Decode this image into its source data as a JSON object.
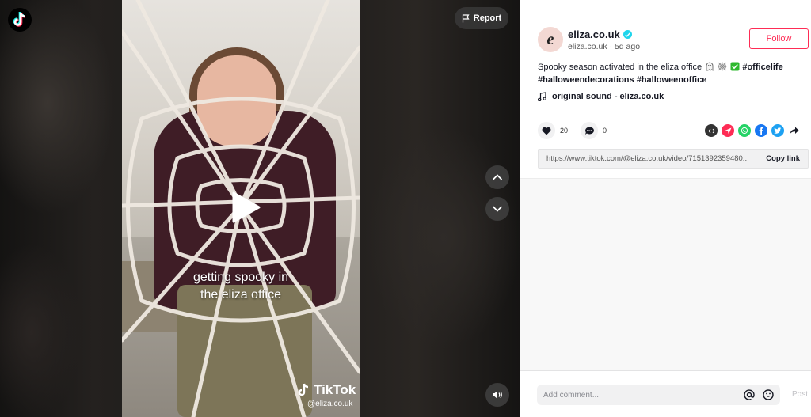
{
  "video": {
    "caption_lines": [
      "getting spooky in",
      "the eliza office"
    ],
    "watermark_brand": "TikTok",
    "watermark_user": "@eliza.co.uk",
    "report_label": "Report"
  },
  "author": {
    "avatar_letter": "e",
    "username": "eliza.co.uk",
    "handle": "eliza.co.uk",
    "age": "5d ago",
    "follow_label": "Follow"
  },
  "description": {
    "text": "Spooky season activated in the eliza office",
    "tags": [
      "#officelife",
      "#halloweendecorations",
      "#halloweenoffice"
    ]
  },
  "sound": "original sound - eliza.co.uk",
  "stats": {
    "likes": "20",
    "comments": "0"
  },
  "share_icons": [
    "embed-icon",
    "tiktok-send-icon",
    "whatsapp-icon",
    "facebook-icon",
    "twitter-icon",
    "share-arrow-icon"
  ],
  "link": {
    "url": "https://www.tiktok.com/@eliza.co.uk/video/7151392359480...",
    "copy_label": "Copy link"
  },
  "comment_input": {
    "placeholder": "Add comment...",
    "post_label": "Post"
  },
  "colors": {
    "brand_red": "#fe2c55",
    "verified": "#20d5ec"
  }
}
